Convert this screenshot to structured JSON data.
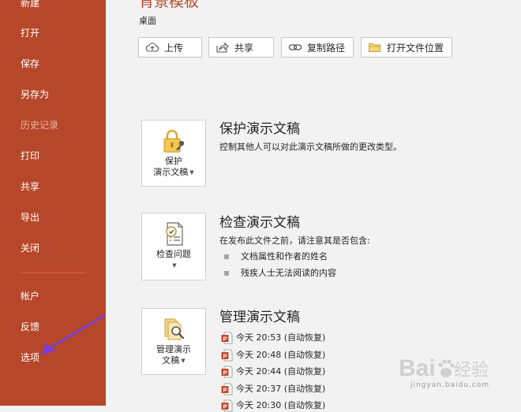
{
  "sidebar": {
    "items": [
      {
        "label": "新建",
        "disabled": false
      },
      {
        "label": "打开",
        "disabled": false
      },
      {
        "label": "保存",
        "disabled": false
      },
      {
        "label": "另存为",
        "disabled": false
      },
      {
        "label": "历史记录",
        "disabled": true
      },
      {
        "label": "打印",
        "disabled": false
      },
      {
        "label": "共享",
        "disabled": false
      },
      {
        "label": "导出",
        "disabled": false
      },
      {
        "label": "关闭",
        "disabled": false
      }
    ],
    "bottom_items": [
      {
        "label": "帐户"
      },
      {
        "label": "反馈"
      },
      {
        "label": "选项"
      }
    ],
    "accent_color": "#b7472a",
    "annotation_arrow_color": "#7b3fd0"
  },
  "header": {
    "file_title": "背景模板",
    "location": "桌面",
    "buttons": {
      "upload": "上传",
      "share": "共享",
      "copy_path": "复制路径",
      "open_location": "打开文件位置"
    }
  },
  "protect": {
    "tile_line1": "保护",
    "tile_line2": "演示文稿",
    "title": "保护演示文稿",
    "description": "控制其他人可以对此演示文稿所做的更改类型。",
    "icon": "lock-key-icon"
  },
  "inspect": {
    "tile_label": "检查问题",
    "title": "检查演示文稿",
    "description": "在发布此文件之前，请注意其是否包含:",
    "bullets": [
      "文档属性和作者的姓名",
      "残疾人士无法阅读的内容"
    ],
    "icon": "checklist-icon"
  },
  "manage": {
    "tile_line1": "管理演示",
    "tile_line2": "文稿",
    "title": "管理演示文稿",
    "icon": "document-search-icon",
    "versions": [
      "今天 20:53 (自动恢复)",
      "今天 20:48 (自动恢复)",
      "今天 20:44 (自动恢复)",
      "今天 20:37 (自动恢复)",
      "今天 20:30 (自动恢复)"
    ]
  },
  "watermark": {
    "brand": "Baidu 经验",
    "url": "jingyan.baidu.com"
  }
}
